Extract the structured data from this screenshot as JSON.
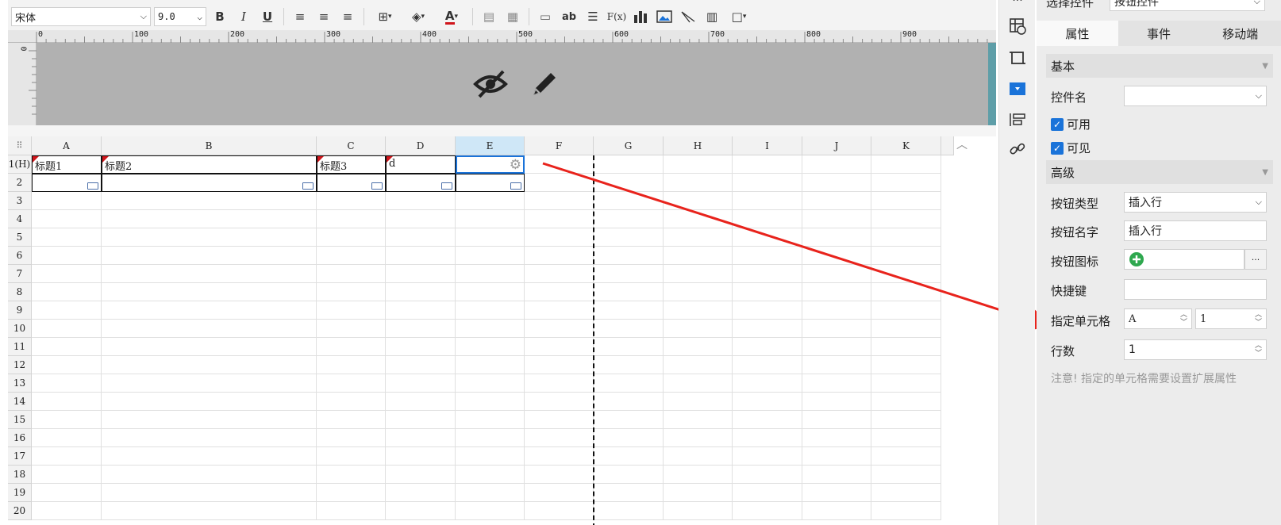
{
  "toolbar": {
    "font_name": "宋体",
    "font_size": "9.0",
    "bold": "B",
    "italic": "I",
    "underline": "U",
    "font_color_label": "A",
    "ab_label": "ab",
    "fx_label": "F(x)"
  },
  "ruler": {
    "marks": [
      "0",
      "100",
      "200",
      "300",
      "400",
      "500",
      "600",
      "700",
      "800",
      "900"
    ],
    "vertical_mark": "0"
  },
  "grid": {
    "columns": [
      "A",
      "B",
      "C",
      "D",
      "E",
      "F",
      "G",
      "H",
      "I",
      "J",
      "K"
    ],
    "rows": [
      "1(H)",
      "2",
      "3",
      "4",
      "5",
      "6",
      "7",
      "8",
      "9",
      "10",
      "11",
      "12",
      "13",
      "14",
      "15",
      "16",
      "17",
      "18",
      "19",
      "20"
    ],
    "cells_row1": [
      "标题1",
      "标题2",
      "标题3",
      "d",
      ""
    ]
  },
  "panel": {
    "select_label": "选择控件",
    "select_value": "按钮控件",
    "tabs": [
      "属性",
      "事件",
      "移动端"
    ],
    "section_basic": "基本",
    "control_name_label": "控件名",
    "control_name_value": "",
    "enabled_label": "可用",
    "visible_label": "可见",
    "section_advanced": "高级",
    "button_type_label": "按钮类型",
    "button_type_value": "插入行",
    "button_name_label": "按钮名字",
    "button_name_value": "插入行",
    "button_icon_label": "按钮图标",
    "button_icon_more": "···",
    "shortcut_label": "快捷键",
    "shortcut_value": "",
    "target_cell_label": "指定单元格",
    "target_cell_col": "A",
    "target_cell_row": "1",
    "row_count_label": "行数",
    "row_count_value": "1",
    "note": "注意! 指定的单元格需要设置扩展属性"
  },
  "colors": {
    "accent": "#1a73d9",
    "arrow": "#e8231c",
    "header_bg": "#b1b1b1",
    "selected_col": "#cfe7f7"
  }
}
